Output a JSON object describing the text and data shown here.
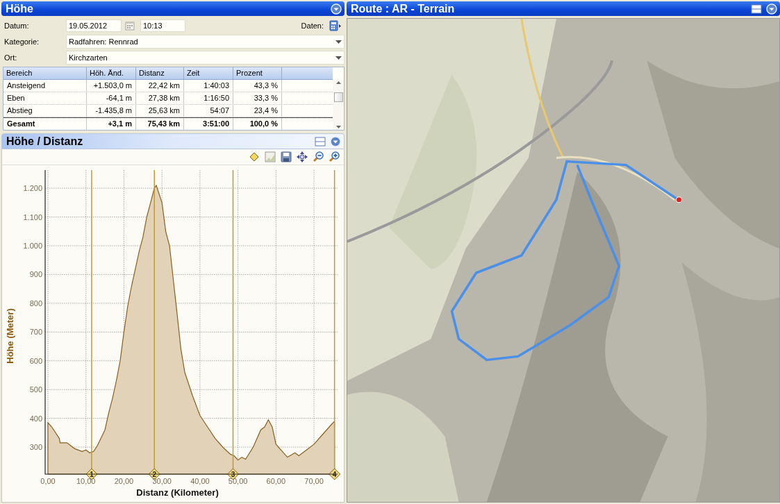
{
  "left_panel": {
    "title": "Höhe"
  },
  "form": {
    "date_label": "Datum:",
    "date": "19.05.2012",
    "time": "10:13",
    "data_label": "Daten:",
    "category_label": "Kategorie:",
    "category": "Radfahren: Rennrad",
    "place_label": "Ort:",
    "place": "Kirchzarten"
  },
  "table": {
    "columns": [
      "Bereich",
      "Höh. Änd.",
      "Distanz",
      "Zeit",
      "Prozent"
    ],
    "rows": [
      {
        "kind": "normal",
        "cells": [
          "Ansteigend",
          "+1.503,0 m",
          "22,42 km",
          "1:40:03",
          "43,3 %"
        ]
      },
      {
        "kind": "normal",
        "cells": [
          "Eben",
          "-64,1 m",
          "27,38 km",
          "1:16:50",
          "33,3 %"
        ]
      },
      {
        "kind": "normal",
        "cells": [
          "Abstieg",
          "-1.435,8 m",
          "25,63 km",
          "54:07",
          "23,4 %"
        ]
      },
      {
        "kind": "total",
        "cells": [
          "Gesamt",
          "+3,1 m",
          "75,43 km",
          "3:51:00",
          "100,0 %"
        ]
      }
    ]
  },
  "chart_panel": {
    "title": "Höhe / Distanz",
    "chart_data": {
      "type": "area",
      "xlabel": "Distanz (Kilometer)",
      "ylabel": "Höhe (Meter)",
      "x": [
        0,
        1,
        3,
        3.2,
        5,
        7,
        9,
        10,
        11,
        12,
        13,
        15,
        16,
        17,
        18,
        19,
        20,
        21,
        22,
        23,
        24,
        25,
        26,
        27,
        28,
        28.5,
        29,
        30,
        31,
        32,
        33,
        34,
        35,
        36,
        38,
        40,
        42,
        44,
        46,
        48,
        49,
        50,
        51,
        52,
        54,
        56,
        57,
        58,
        59,
        60,
        62,
        63,
        65,
        66,
        68,
        70,
        72,
        74,
        75.4
      ],
      "series": [
        {
          "color": "#8a6020",
          "values": [
            385,
            370,
            330,
            315,
            315,
            295,
            285,
            290,
            280,
            285,
            305,
            360,
            420,
            470,
            530,
            600,
            700,
            790,
            860,
            920,
            980,
            1030,
            1100,
            1150,
            1200,
            1210,
            1190,
            1150,
            1050,
            1000,
            880,
            760,
            640,
            560,
            480,
            410,
            370,
            330,
            300,
            275,
            270,
            255,
            265,
            258,
            300,
            360,
            370,
            395,
            370,
            310,
            280,
            265,
            280,
            270,
            290,
            310,
            340,
            370,
            390
          ]
        }
      ],
      "xlim": [
        -0.73,
        76.2
      ],
      "ylim": [
        206,
        1263
      ],
      "xticks": [
        {
          "value": 0,
          "label": "0,00"
        },
        {
          "value": 10,
          "label": "10,00"
        },
        {
          "value": 20,
          "label": "20,00"
        },
        {
          "value": 30,
          "label": "30,00"
        },
        {
          "value": 40,
          "label": "40,00"
        },
        {
          "value": 50,
          "label": "50,00"
        },
        {
          "value": 60,
          "label": "60,00"
        },
        {
          "value": 70,
          "label": "70,00"
        }
      ],
      "yticks": [
        {
          "value": 300,
          "label": "300"
        },
        {
          "value": 400,
          "label": "400"
        },
        {
          "value": 500,
          "label": "500"
        },
        {
          "value": 600,
          "label": "600"
        },
        {
          "value": 700,
          "label": "700"
        },
        {
          "value": 800,
          "label": "800"
        },
        {
          "value": 900,
          "label": "900"
        },
        {
          "value": 1000,
          "label": "1.000"
        },
        {
          "value": 1100,
          "label": "1.100"
        },
        {
          "value": 1200,
          "label": "1.200"
        }
      ],
      "grid": true,
      "ref_lines": [
        {
          "axis": "x",
          "value": 11.5
        },
        {
          "axis": "x",
          "value": 28
        },
        {
          "axis": "x",
          "value": 48.7
        },
        {
          "axis": "x",
          "value": 75.4
        }
      ],
      "annotations": [
        {
          "x": 11.5,
          "y": 206,
          "text": "1"
        },
        {
          "x": 28,
          "y": 206,
          "text": "2"
        },
        {
          "x": 48.7,
          "y": 206,
          "text": "3"
        },
        {
          "x": 75.4,
          "y": 206,
          "text": "4"
        }
      ]
    }
  },
  "map_panel": {
    "title": "Route : AR - Terrain"
  }
}
